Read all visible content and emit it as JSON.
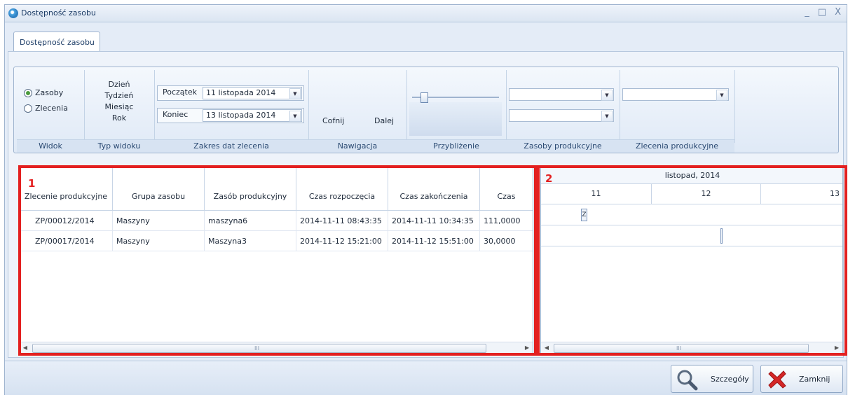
{
  "window": {
    "title": "Dostępność zasobu",
    "controls": [
      "_",
      "□",
      "X"
    ]
  },
  "tab": {
    "label": "Dostępność zasobu"
  },
  "ribbon": {
    "widok": {
      "label": "Widok",
      "options": [
        {
          "label": "Zasoby",
          "checked": true
        },
        {
          "label": "Zlecenia",
          "checked": false
        }
      ]
    },
    "typ_widoku": {
      "label": "Typ widoku",
      "items": [
        "Dzień",
        "Tydzień",
        "Miesiąc",
        "Rok"
      ]
    },
    "zakres": {
      "label": "Zakres dat zlecenia",
      "start_label": "Początek",
      "start_value": "11 listopada 2014",
      "end_label": "Koniec",
      "end_value": "13 listopada 2014"
    },
    "nawigacja": {
      "label": "Nawigacja",
      "back": "Cofnij",
      "next": "Dalej"
    },
    "przyblizenie": {
      "label": "Przybliżenie",
      "level": 0.1
    },
    "zasoby": {
      "label": "Zasoby produkcyjne",
      "combo1": "",
      "combo2": ""
    },
    "zlecenia": {
      "label": "Zlecenia produkcyjne",
      "combo1": ""
    }
  },
  "grid": {
    "marker": "1",
    "columns": [
      "Zlecenie produkcyjne",
      "Grupa zasobu",
      "Zasób produkcyjny",
      "Czas rozpoczęcia",
      "Czas zakończenia",
      "Czas"
    ],
    "rows": [
      [
        "ZP/00012/2014",
        "Maszyny",
        "maszyna6",
        "2014-11-11 08:43:35",
        "2014-11-11 10:34:35",
        "111,0000"
      ],
      [
        "ZP/00017/2014",
        "Maszyny",
        "Maszyna3",
        "2014-11-12 15:21:00",
        "2014-11-12 15:51:00",
        "30,0000"
      ]
    ],
    "scroll_grip": "III"
  },
  "gantt": {
    "marker": "2",
    "month": "listopad, 2014",
    "days": [
      "11",
      "12",
      "13"
    ],
    "bar_label": "Z",
    "scroll_grip": "III"
  },
  "buttons": {
    "details": "Szczegóły",
    "close": "Zamknij"
  },
  "colors": {
    "highlight": "#e32020",
    "accent": "#9fb4cf"
  }
}
